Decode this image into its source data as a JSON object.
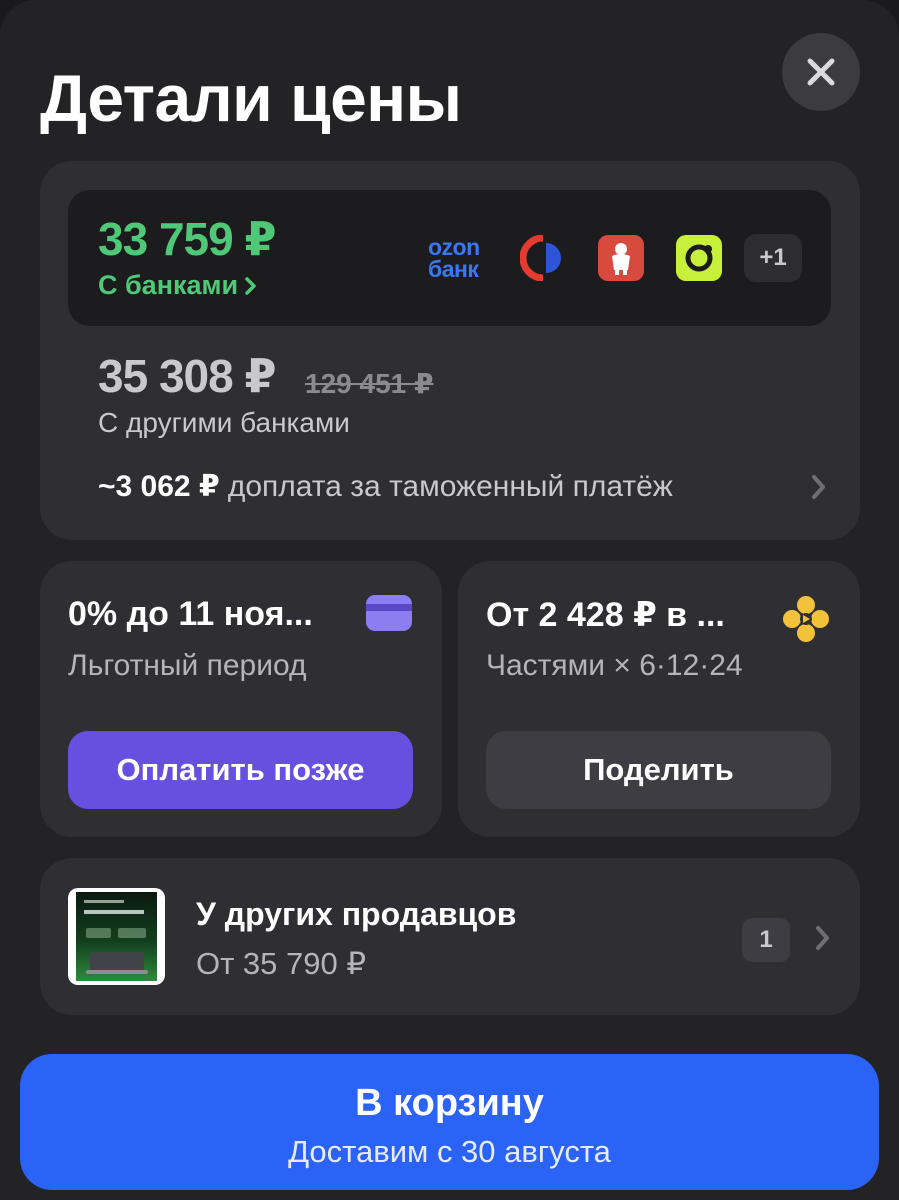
{
  "header": {
    "title": "Детали цены"
  },
  "price_with_banks": {
    "price": "33 759 ₽",
    "label": "С банками",
    "logos": [
      "ozon-bank",
      "sovcombank",
      "moscow-bank",
      "green-bank"
    ],
    "ozon_logo_line1": "ozon",
    "ozon_logo_line2": "банк",
    "more_banks": "+1"
  },
  "price_other_banks": {
    "price": "35 308 ₽",
    "old_price": "129 451 ₽",
    "label": "С другими банками"
  },
  "customs": {
    "amount": "~3 062 ₽",
    "text": "доплата за таможенный платёж"
  },
  "pay_later": {
    "title": "0% до 11 ноя...",
    "subtitle": "Льготный период",
    "button": "Оплатить позже"
  },
  "installments": {
    "title": "От 2 428 ₽ в ...",
    "subtitle": "Частями × 6·12·24",
    "button": "Поделить"
  },
  "other_sellers": {
    "title": "У других продавцов",
    "price": "От 35 790 ₽",
    "count": "1"
  },
  "cart": {
    "title": "В корзину",
    "delivery": "Доставим с 30 августа"
  },
  "colors": {
    "accent_green": "#4fc878",
    "accent_purple": "#6750e0",
    "accent_blue": "#2a63f6"
  }
}
